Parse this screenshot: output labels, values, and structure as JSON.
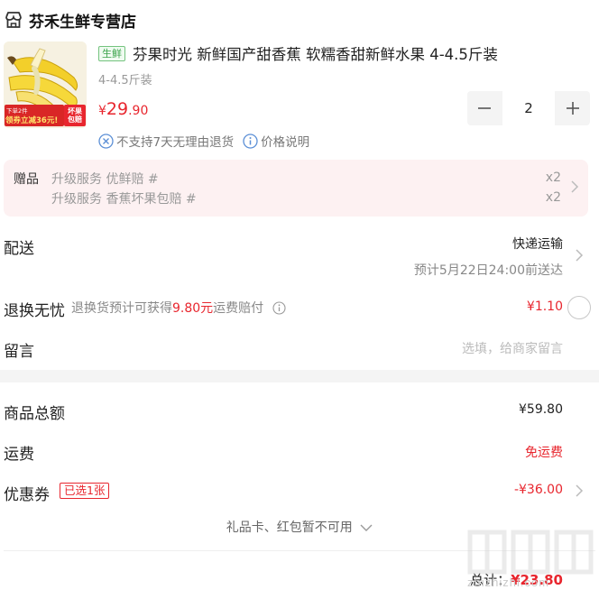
{
  "store": {
    "name": "芬禾生鲜专营店",
    "icon": "shop-icon"
  },
  "product": {
    "tag": "生鲜",
    "title": "芬果时光 新鲜国产甜香蕉 软糯香甜新鲜水果 4-4.5斤装",
    "spec": "4-4.5斤装",
    "price_currency": "¥",
    "price_int": "29",
    "price_dec": ".90",
    "quantity": "2",
    "thumb_badge_left": "领券立减36元!",
    "thumb_badge_left_top": "下单2件",
    "thumb_badge_right": "坏果包赔",
    "policy_no_return": "不支持7天无理由退货",
    "policy_price_note": "价格说明"
  },
  "gifts": {
    "label": "赠品",
    "items": [
      {
        "text": "升级服务 优鲜赔 #",
        "qty": "x2"
      },
      {
        "text": "升级服务 香蕉坏果包赔 #",
        "qty": "x2"
      }
    ]
  },
  "delivery": {
    "label": "配送",
    "method": "快递运输",
    "eta": "预计5月22日24:00前送达"
  },
  "return_insurance": {
    "label": "退换无忧",
    "note_prefix": "退换货预计可获得",
    "note_amount": "9.80元",
    "note_suffix": "运费赔付",
    "price": "¥1.10"
  },
  "message": {
    "label": "留言",
    "placeholder": "选填，给商家留言"
  },
  "summary": {
    "goods_total_label": "商品总额",
    "goods_total_value": "¥59.80",
    "shipping_label": "运费",
    "shipping_value": "免运费",
    "coupon_label": "优惠券",
    "coupon_badge": "已选1张",
    "coupon_value": "-¥36.00",
    "giftcard_note": "礼品卡、红包暂不可用",
    "total_label": "总计：",
    "total_value": "¥23.80"
  },
  "watermark": {
    "text": "zhizhizhi.com"
  },
  "colors": {
    "accent_red": "#e8262e",
    "fresh_green": "#3aa34a",
    "gift_bg": "#fdf1f2"
  }
}
